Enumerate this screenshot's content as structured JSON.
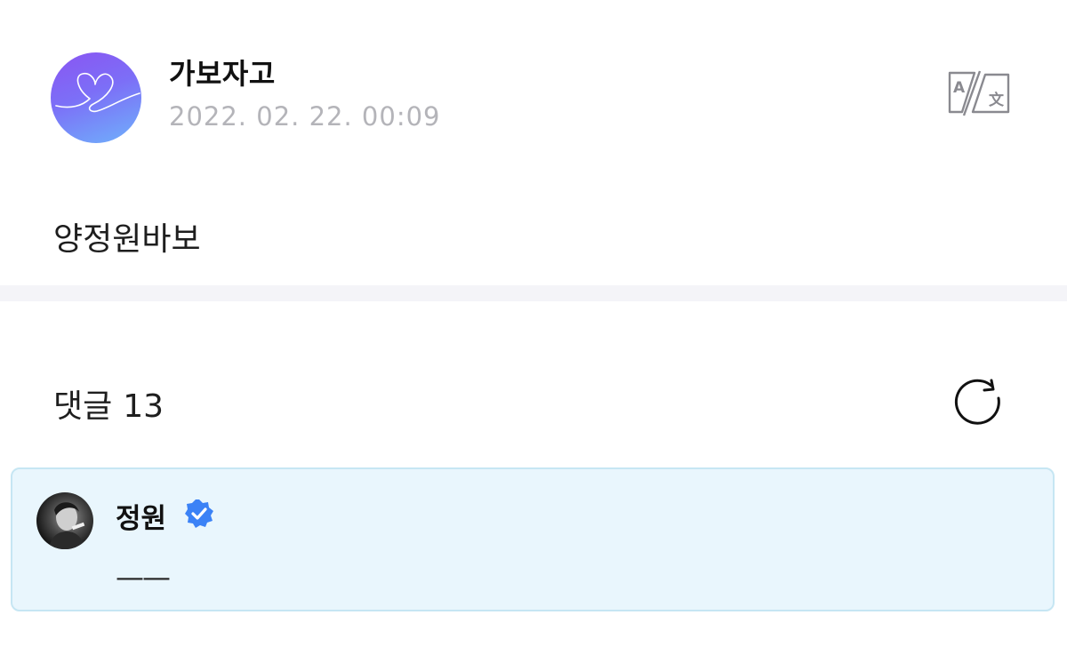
{
  "post": {
    "author_name": "가보자고",
    "timestamp": "2022. 02. 22. 00:09",
    "body": "양정원바보",
    "translate_icon": "translate-icon"
  },
  "comments": {
    "label": "댓글",
    "count": "13",
    "refresh_icon": "refresh-icon"
  },
  "highlighted_comment": {
    "author_name": "정원",
    "verified_icon": "verified-badge-icon",
    "text": "——"
  },
  "colors": {
    "avatar_gradient_start": "#8a55f2",
    "avatar_gradient_end": "#6fb1fb",
    "timestamp": "#b4b4b9",
    "comment_card_bg": "#e9f6fd",
    "comment_card_border": "#c6e6f3",
    "verified_badge": "#3b82f6"
  }
}
